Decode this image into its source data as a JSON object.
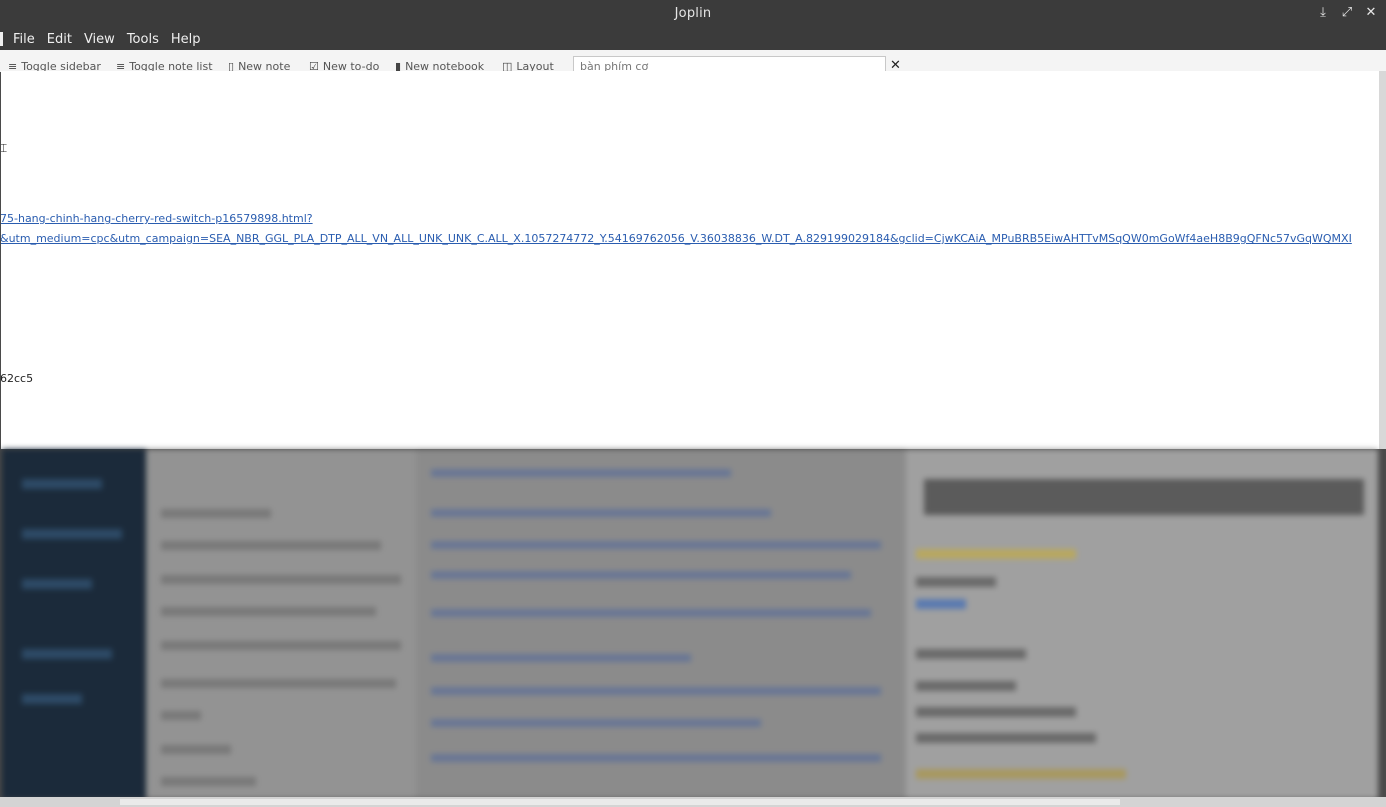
{
  "window": {
    "title": "Joplin",
    "controls": {
      "minimize_icon": "download-arrow-icon",
      "maximize_icon": "expand-icon",
      "close_icon": "close-icon"
    }
  },
  "menubar": {
    "items": [
      "File",
      "Edit",
      "View",
      "Tools",
      "Help"
    ]
  },
  "toolbar": {
    "toggle_sidebar": "Toggle sidebar",
    "toggle_note_list": "Toggle note list",
    "new_note": "New note",
    "new_todo": "New to-do",
    "new_notebook": "New notebook",
    "layout": "Layout",
    "search_value": "bàn phím cơ"
  },
  "document": {
    "link_line_1": "75-hang-chinh-hang-cherry-red-switch-p16579898.html?",
    "link_line_2": "&utm_medium=cpc&utm_campaign=SEA_NBR_GGL_PLA_DTP_ALL_VN_ALL_UNK_UNK_C.ALL_X.1057274772_Y.54169762056_V.36038836_W.DT_A.829199029184&gclid=CjwKCAiA_MPuBRB5EiwAHTTvMSqQW0mGoWf4aeH8B9gQFNc57vGqWQMXI",
    "plain_text": "62cc5"
  },
  "colors": {
    "link": "#2a5db0",
    "titlebar": "#3b3b3b",
    "toolbar": "#f4f4f4"
  }
}
